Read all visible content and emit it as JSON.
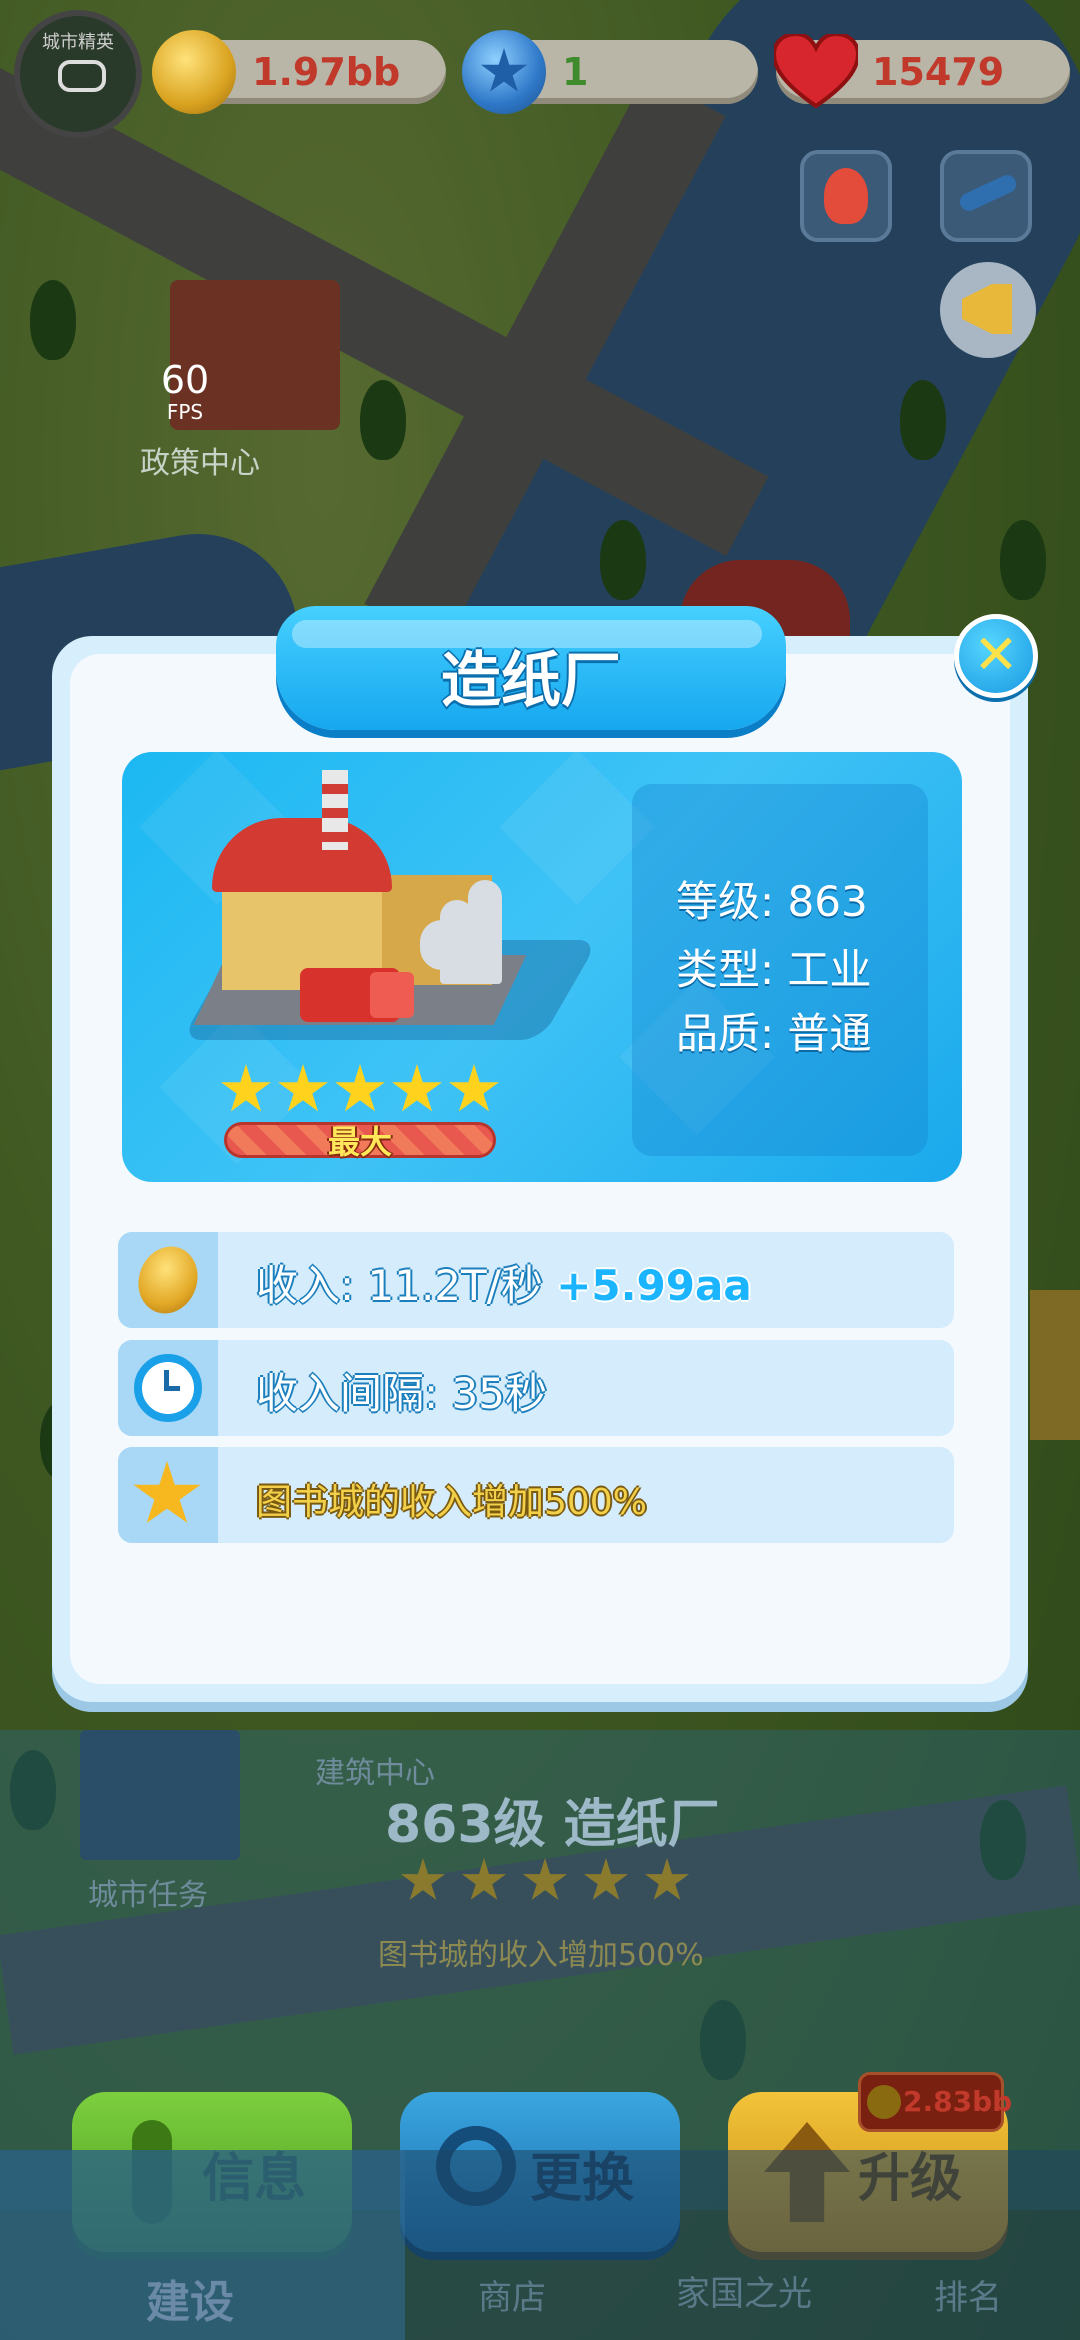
{
  "topbar": {
    "avatar_text": "城市精英",
    "coins": "1.97bb",
    "stars": "1",
    "hearts": "15479",
    "colors": {
      "coins": "#c0392b",
      "stars": "#3f8a2a",
      "hearts": "#c0392b"
    }
  },
  "hud": {
    "fps_value": "60",
    "fps_label": "FPS",
    "scene_building_label": "政策中心",
    "icons": [
      "fox-icon",
      "airplane-icon",
      "megaphone-icon"
    ]
  },
  "modal": {
    "title": "造纸厂",
    "stats": {
      "level": "等级: 863",
      "type": "类型: 工业",
      "quality": "品质: 普通"
    },
    "stars_count": 5,
    "max_label": "最大",
    "rows": [
      {
        "icon": "coin-icon",
        "text": "收入: 11.2T/秒",
        "highlight": "+5.99aa"
      },
      {
        "icon": "clock-icon",
        "text": "收入间隔: 35秒"
      },
      {
        "icon": "star-icon",
        "text": "图书城的收入增加500%"
      }
    ]
  },
  "background_panel": {
    "subtitle": "建筑中心",
    "title": "863级 造纸厂",
    "effect": "图书城的收入增加500%",
    "side_label": "城市任务"
  },
  "actions": {
    "info": "信息",
    "swap": "更换",
    "upgrade": "升级",
    "upgrade_cost": "2.83bb"
  },
  "tabs": [
    "建设",
    "商店",
    "家国之光",
    "排名"
  ]
}
